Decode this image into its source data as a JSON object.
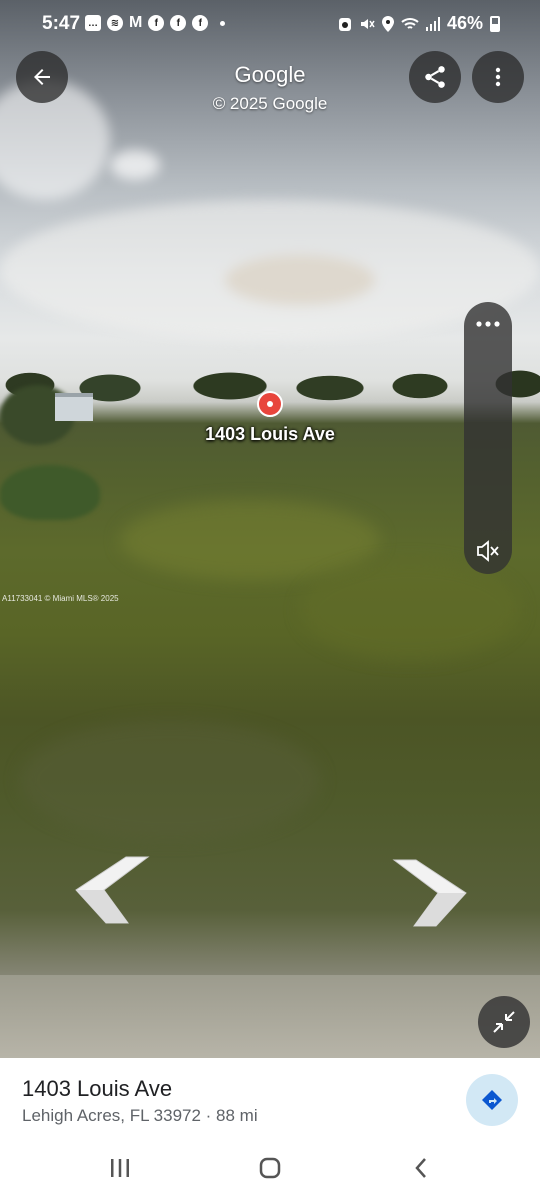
{
  "status_bar": {
    "time": "5:47",
    "battery": "46%"
  },
  "header": {
    "title": "Google",
    "subtitle": "© 2025 Google"
  },
  "street_view": {
    "marker_label": "1403 Louis Ave",
    "watermark": "A11733041 © Miami MLS® 2025"
  },
  "place_card": {
    "name": "1403 Louis Ave",
    "details": "Lehigh Acres, FL 33972 · 88 mi"
  },
  "icons": [
    "back-icon",
    "share-icon",
    "more-vert-icon",
    "more-horiz-icon",
    "mute-icon",
    "chevron-left-icon",
    "chevron-right-icon",
    "collapse-icon",
    "directions-icon",
    "recents-icon",
    "home-icon",
    "back-nav-icon"
  ],
  "colors": {
    "marker": "#e8453c",
    "directions_bg": "#d2e8f5",
    "directions_icon": "#0b57d0"
  }
}
